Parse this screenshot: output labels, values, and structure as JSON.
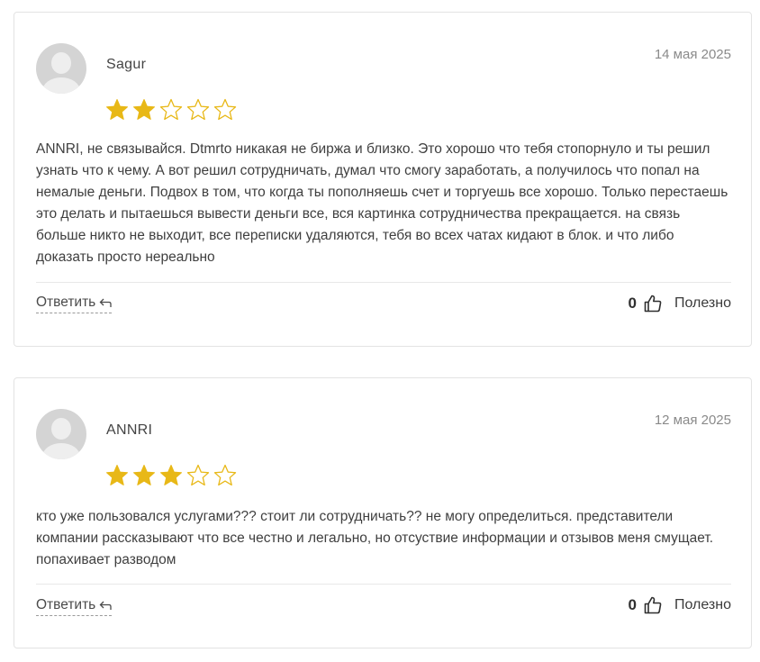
{
  "colors": {
    "star_filled": "#e8b817",
    "star_outline": "#e8b817",
    "border": "#e3e3e3"
  },
  "reviews": [
    {
      "author": "Sagur",
      "date": "14 мая 2025",
      "rating": 2,
      "text": "ANNRI, не связывайся. Dtmrto никакая не биржа и близко. Это хорошо что тебя стопорнуло и ты решил узнать что к чему. А вот решил сотрудничать, думал что смогу заработать, а получилось что попал на немалые деньги. Подвох в том, что когда ты пополняешь счет и торгуешь все хорошо. Только перестаешь это делать и пытаешься вывести деньги все, вся картинка сотрудничества прекращается. на связь больше никто не выходит, все переписки удаляются, тебя во всех чатах кидают в блок. и что либо доказать просто нереально",
      "reply_label": "Ответить",
      "useful_count": "0",
      "useful_label": "Полезно"
    },
    {
      "author": "ANNRI",
      "date": "12 мая 2025",
      "rating": 3,
      "text": "кто уже пользовался услугами??? стоит ли сотрудничать?? не могу определиться. представители компании рассказывают что все честно и легально, но отсуствие информации и отзывов меня смущает. попахивает разводом",
      "reply_label": "Ответить",
      "useful_count": "0",
      "useful_label": "Полезно"
    }
  ]
}
